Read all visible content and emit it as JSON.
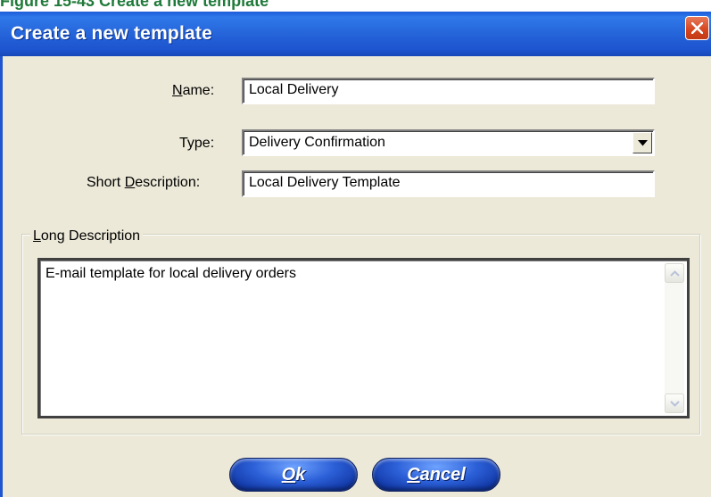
{
  "background_strip": {
    "partial_text": "Figure 15-43 Create a new template"
  },
  "window": {
    "title": "Create a new template"
  },
  "form": {
    "name": {
      "label_access_key": "N",
      "label_rest": "ame:",
      "value": "Local Delivery"
    },
    "type": {
      "label": "Type:",
      "selected": "Delivery Confirmation"
    },
    "short_description": {
      "label_before": "Short ",
      "label_access_key": "D",
      "label_rest": "escription:",
      "value": "Local Delivery Template"
    },
    "long_description": {
      "label_access_key": "L",
      "label_rest": "ong Description",
      "value": "E-mail template for local delivery orders"
    }
  },
  "buttons": {
    "ok": {
      "access_key": "O",
      "rest": "k"
    },
    "cancel": {
      "access_key": "C",
      "rest": "ancel"
    }
  },
  "colors": {
    "titlebar": "#2462d8",
    "dialog_background": "#ece9d8",
    "close_button": "#d5441d",
    "button_blue": "#2c60d8"
  }
}
